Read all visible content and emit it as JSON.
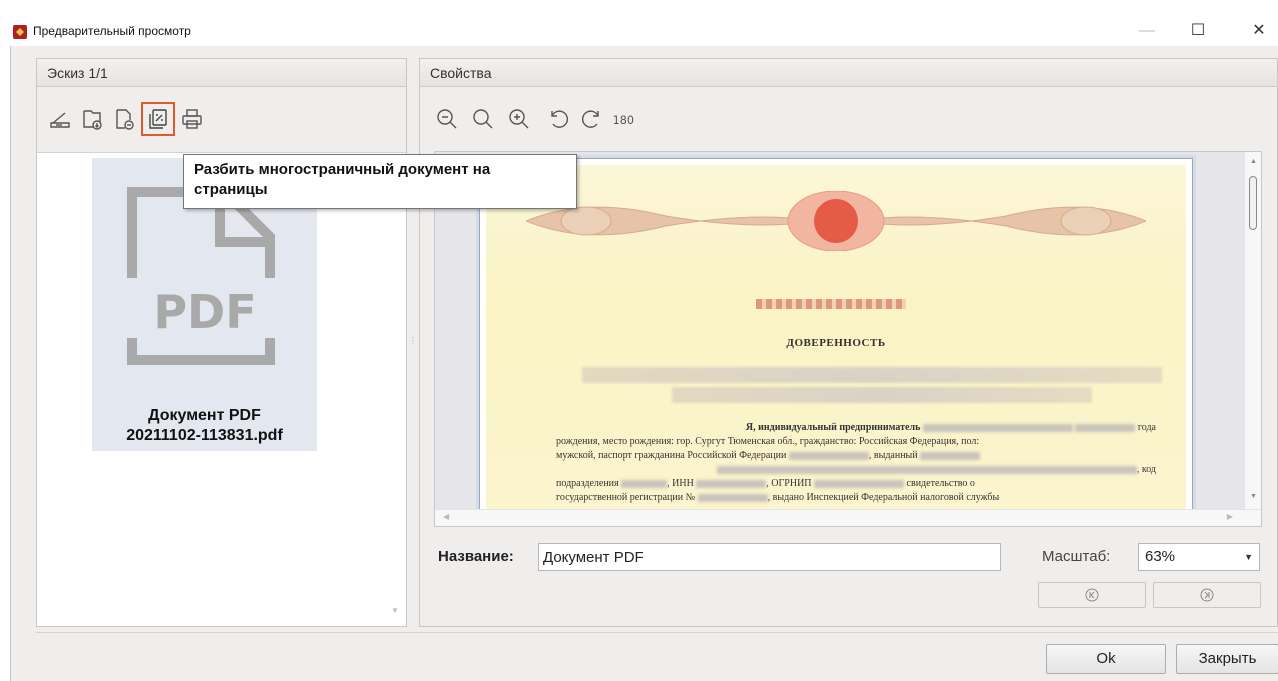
{
  "window": {
    "title": "Предварительный просмотр",
    "controls": {
      "minimize": "—",
      "maximize": "☐",
      "close": "✕"
    }
  },
  "left_panel": {
    "header": "Эскиз 1/1",
    "toolbar": [
      {
        "name": "scan-icon"
      },
      {
        "name": "import-file-icon"
      },
      {
        "name": "remove-file-icon"
      },
      {
        "name": "split-document-icon",
        "active": true
      },
      {
        "name": "print-icon"
      }
    ],
    "tooltip": "Разбить многостраничный документ на страницы",
    "thumbnail": {
      "badge": "PDF",
      "title_line1": "Документ PDF",
      "title_line2": "20211102-113831.pdf"
    }
  },
  "right_panel": {
    "header": "Свойства",
    "toolbar": [
      {
        "name": "zoom-out-icon"
      },
      {
        "name": "zoom-fit-icon"
      },
      {
        "name": "zoom-in-icon"
      },
      {
        "name": "rotate-left-icon"
      },
      {
        "name": "rotate-right-icon"
      },
      {
        "name": "rotate-180-icon",
        "label": "180"
      }
    ],
    "document": {
      "heading": "ДОВЕРЕННОСТЬ",
      "body_fragments": [
        "Я, индивидуальный предприниматель",
        "года",
        "рождения, место рождения: гор. Сургут Тюменская обл., гражданство: Российская Федерация, пол:",
        "мужской, паспорт гражданина Российской Федерации",
        ", выданный",
        ", код",
        "подразделения",
        ", ИНН",
        ", ОГРНИП",
        "свидетельство о",
        "государственной регистрации №",
        ", выдано Инспекцией Федеральной налоговой службы"
      ]
    },
    "name_label": "Название:",
    "name_value": "Документ PDF",
    "scale_label": "Масштаб:",
    "scale_value": "63%"
  },
  "buttons": {
    "ok": "Ok",
    "close": "Закрыть"
  },
  "colors": {
    "accent_highlight": "#e05a2a",
    "dialog_bg": "#f0eeed",
    "thumb_card": "#e3e7ef"
  }
}
